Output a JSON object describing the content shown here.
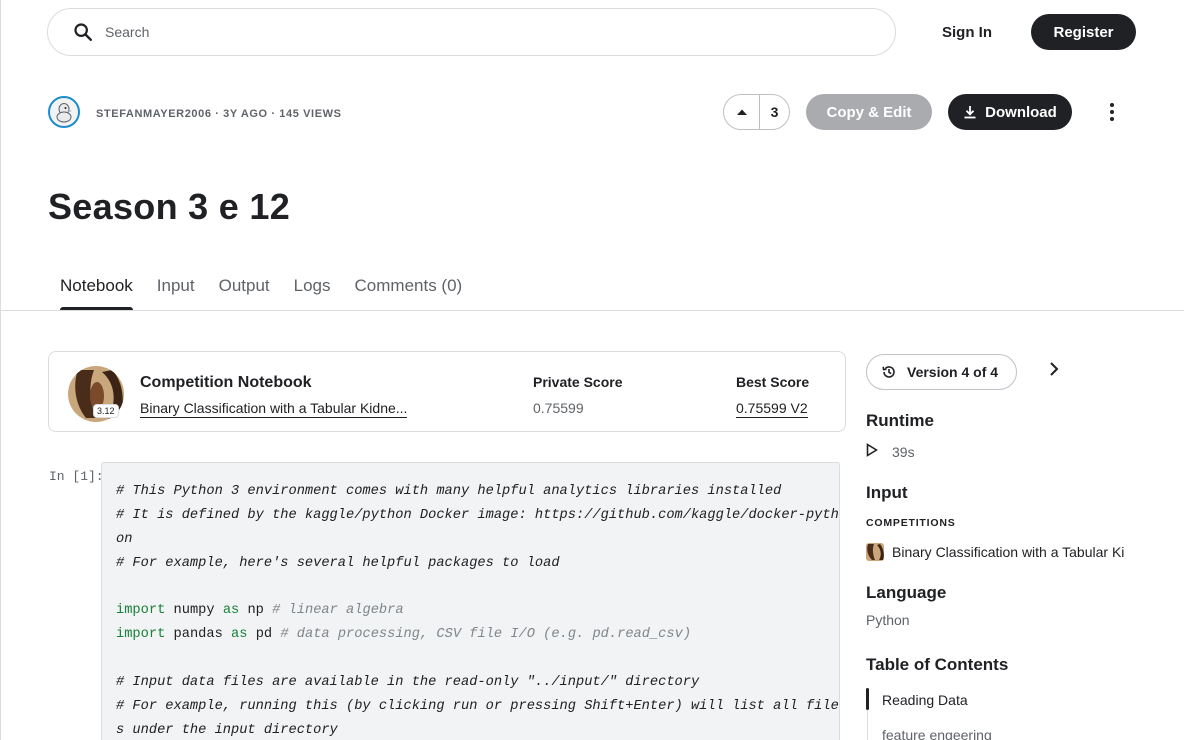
{
  "search": {
    "placeholder": "Search"
  },
  "header": {
    "signin_label": "Sign In",
    "register_label": "Register"
  },
  "author": {
    "meta": "STEFANMAYER2006 · 3Y AGO · 145 VIEWS"
  },
  "actions": {
    "vote_count": "3",
    "copy_edit_label": "Copy & Edit",
    "download_label": "Download"
  },
  "page_title": "Season 3 e 12",
  "tabs": [
    {
      "label": "Notebook"
    },
    {
      "label": "Input"
    },
    {
      "label": "Output"
    },
    {
      "label": "Logs"
    },
    {
      "label": "Comments (0)"
    }
  ],
  "competition": {
    "heading": "Competition Notebook",
    "name": "Binary Classification with a Tabular Kidne...",
    "badge": "3.12",
    "private_score_label": "Private Score",
    "private_score": "0.75599",
    "best_score_label": "Best Score",
    "best_score": "0.75599 V2"
  },
  "cell": {
    "prompt": "In [1]:",
    "lines": [
      "# This Python 3 environment comes with many helpful analytics libraries installed",
      "# It is defined by the kaggle/python Docker image: https://github.com/kaggle/docker-pyth",
      "on",
      "# For example, here's several helpful packages to load",
      "",
      "import numpy as np # linear algebra",
      "import pandas as pd # data processing, CSV file I/O (e.g. pd.read_csv)",
      "",
      "# Input data files are available in the read-only \"../input/\" directory",
      "# For example, running this (by clicking run or pressing Shift+Enter) will list all file",
      "s under the input directory"
    ]
  },
  "sidebar": {
    "version_label": "Version 4 of 4",
    "runtime_heading": "Runtime",
    "runtime_value": "39s",
    "input_heading": "Input",
    "competitions_caption": "COMPETITIONS",
    "input_item": "Binary Classification with a Tabular Ki",
    "language_heading": "Language",
    "language_value": "Python",
    "toc_heading": "Table of Contents",
    "toc_items": [
      {
        "label": "Reading Data"
      },
      {
        "label": "feature engeering"
      }
    ]
  },
  "colors": {
    "accent": "#202124",
    "disabled_button": "#a9abae",
    "avatar_ring": "#1e8ccd",
    "code_bg": "#f1f3f4"
  }
}
